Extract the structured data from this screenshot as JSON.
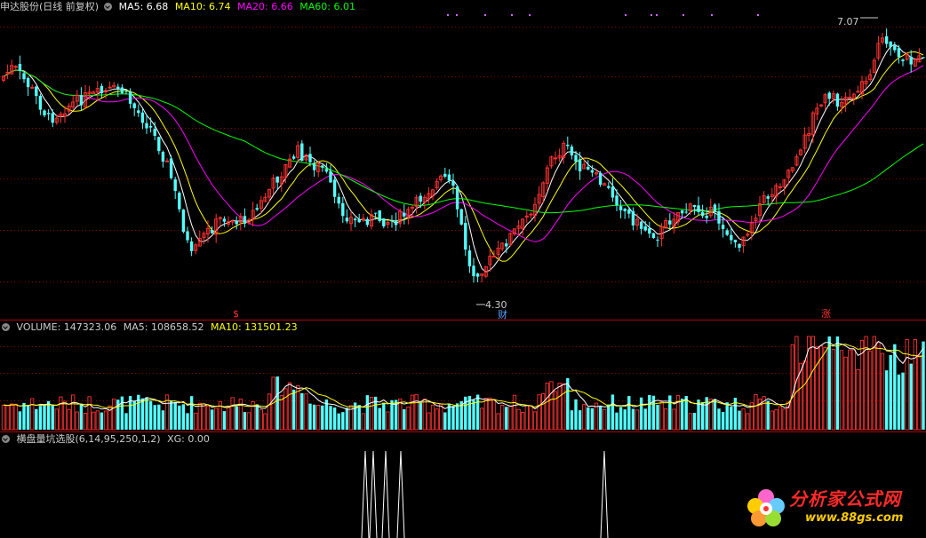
{
  "main_header": {
    "title": "申达股份(日线 前复权)",
    "ma5_label": "MA5: 6.68",
    "ma10_label": "MA10: 6.74",
    "ma20_label": "MA20: 6.66",
    "ma60_label": "MA60: 6.01"
  },
  "volume_header": {
    "volume_label": "VOLUME: 147323.06",
    "ma5_label": "MA5: 108658.52",
    "ma10_label": "MA10: 131501.23"
  },
  "indicator_header": {
    "label": "横盘量坑选股(6,14,95,250,1,2)",
    "xg_label": "XG: 0.00"
  },
  "colors": {
    "up": "#ff3232",
    "down": "#54ffff",
    "ma5": "#ffffff",
    "ma10": "#ffff00",
    "ma20": "#ff00ff",
    "ma60": "#00ff00",
    "grid": "#8b0000"
  },
  "annotations": {
    "high_label": "7.07",
    "low_label": "4.30",
    "marker_s": "$",
    "marker_cai": "财",
    "marker_zhang": "涨"
  },
  "watermark": {
    "text": "分析家公式网",
    "url": "www.88gs.com"
  },
  "chart_data": [
    {
      "type": "candlestick",
      "title": "申达股份(日线 前复权)",
      "ylim": [
        4.0,
        7.2
      ],
      "series": [
        {
          "name": "MA5",
          "value": 6.68
        },
        {
          "name": "MA10",
          "value": 6.74
        },
        {
          "name": "MA20",
          "value": 6.66
        },
        {
          "name": "MA60",
          "value": 6.01
        }
      ],
      "key_points": {
        "high": 7.07,
        "low": 4.3
      }
    },
    {
      "type": "bar",
      "title": "VOLUME",
      "series": [
        {
          "name": "VOLUME",
          "value": 147323.06
        },
        {
          "name": "MA5",
          "value": 108658.52
        },
        {
          "name": "MA10",
          "value": 131501.23
        }
      ]
    },
    {
      "type": "line",
      "title": "横盘量坑选股(6,14,95,250,1,2)",
      "series": [
        {
          "name": "XG",
          "value": 0.0
        }
      ],
      "signal_bars": 5
    }
  ]
}
